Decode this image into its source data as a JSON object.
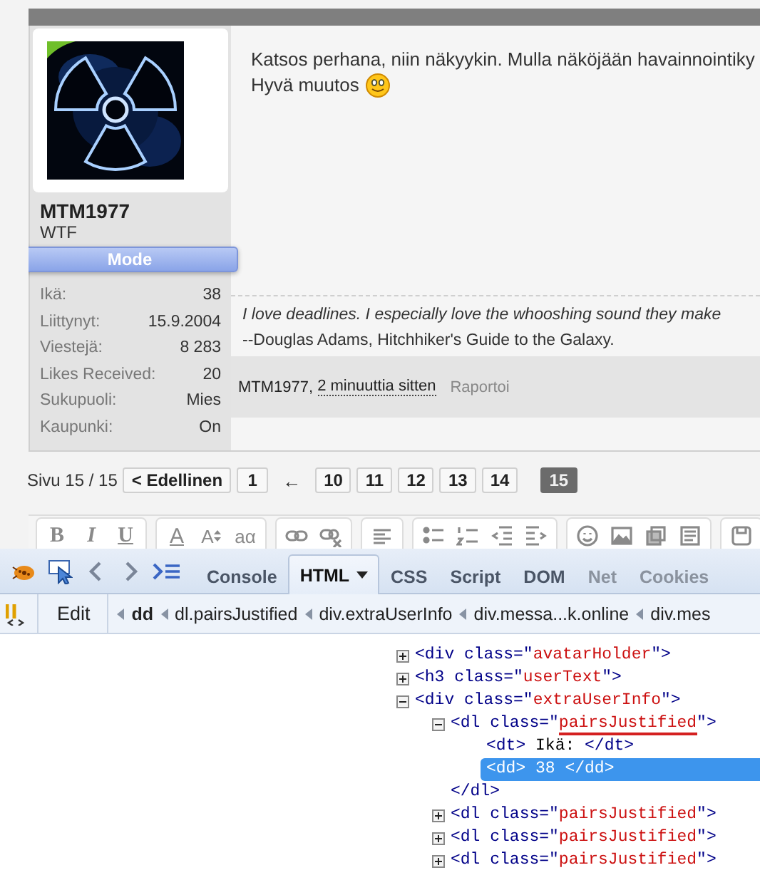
{
  "post": {
    "author": {
      "name": "MTM1977",
      "title": "WTF",
      "badge": "Mode",
      "stats": [
        {
          "label": "Ikä:",
          "value": "38"
        },
        {
          "label": "Liittynyt:",
          "value": "15.9.2004"
        },
        {
          "label": "Viestejä:",
          "value": "8 283"
        },
        {
          "label": "Likes Received:",
          "value": "20"
        },
        {
          "label": "Sukupuoli:",
          "value": "Mies"
        },
        {
          "label": "Kaupunki:",
          "value": "On"
        }
      ]
    },
    "message": [
      "Katsos perhana, niin näkyykin. Mulla näköjään havainnointiky",
      "Hyvä muutos"
    ],
    "signature": [
      "I love deadlines. I especially love the whooshing sound they make",
      "--Douglas Adams, Hitchhiker's Guide to the Galaxy."
    ],
    "footer": {
      "author": "MTM1977,",
      "time": "2 minuuttia sitten",
      "report": "Raportoi"
    }
  },
  "pagination": {
    "label": "Sivu 15 / 15",
    "previous": "< Edellinen",
    "first_pages": [
      {
        "label": "1",
        "selected": false
      }
    ],
    "gap": "←",
    "pages": [
      {
        "label": "10",
        "selected": false
      },
      {
        "label": "11",
        "selected": false
      },
      {
        "label": "12",
        "selected": false
      },
      {
        "label": "13",
        "selected": false
      },
      {
        "label": "14",
        "selected": false
      },
      {
        "label": "15",
        "selected": true
      }
    ]
  },
  "editor_toolbar": {
    "bold": "B",
    "italic": "I",
    "underline": "U",
    "font_color": "A",
    "font_size": "A",
    "style": "aα"
  },
  "firebug": {
    "tabs": [
      {
        "label": "Console",
        "selected": false,
        "disabled": false
      },
      {
        "label": "HTML",
        "selected": true,
        "disabled": false
      },
      {
        "label": "CSS",
        "selected": false,
        "disabled": false
      },
      {
        "label": "Script",
        "selected": false,
        "disabled": false
      },
      {
        "label": "DOM",
        "selected": false,
        "disabled": false
      },
      {
        "label": "Net",
        "selected": false,
        "disabled": true
      },
      {
        "label": "Cookies",
        "selected": false,
        "disabled": true
      }
    ],
    "edit": "Edit",
    "breadcrumb": [
      {
        "label": "dd",
        "selected": true
      },
      {
        "label": "dl.pairsJustified",
        "selected": false
      },
      {
        "label": "div.extraUserInfo",
        "selected": false
      },
      {
        "label": "div.messa...k.online",
        "selected": false
      },
      {
        "label": "div.mes",
        "selected": false
      }
    ],
    "tree": [
      {
        "kind": "element",
        "open": "<div",
        "attr": "class=\"",
        "value": "avatarHolder",
        "close": "\">",
        "expanded": false,
        "selected": false,
        "underlined": false
      },
      {
        "kind": "element",
        "open": "<h3",
        "attr": "class=\"",
        "value": "userText",
        "close": "\">",
        "expanded": false,
        "selected": false,
        "underlined": false
      },
      {
        "kind": "element",
        "open": "<div",
        "attr": "class=\"",
        "value": "extraUserInfo",
        "close": "\">",
        "expanded": true,
        "selected": false,
        "underlined": false,
        "children": [
          {
            "kind": "element",
            "open": "<dl",
            "attr": "class=\"",
            "value": "pairsJustified",
            "close": "\">",
            "expanded": true,
            "selected": false,
            "underlined": true,
            "end": "</dl>",
            "children": [
              {
                "kind": "text",
                "open": "<dt>",
                "text": "Ikä:",
                "close": "</dt>",
                "selected": false
              },
              {
                "kind": "text",
                "open": "<dd>",
                "text": "38",
                "close": "</dd>",
                "selected": true
              }
            ]
          },
          {
            "kind": "element",
            "open": "<dl",
            "attr": "class=\"",
            "value": "pairsJustified",
            "close": "\">",
            "expanded": false,
            "selected": false,
            "underlined": false
          },
          {
            "kind": "element",
            "open": "<dl",
            "attr": "class=\"",
            "value": "pairsJustified",
            "close": "\">",
            "expanded": false,
            "selected": false,
            "underlined": false
          },
          {
            "kind": "element",
            "open": "<dl",
            "attr": "class=\"",
            "value": "pairsJustified",
            "close": "\">",
            "expanded": false,
            "selected": false,
            "underlined": false
          }
        ]
      }
    ]
  }
}
